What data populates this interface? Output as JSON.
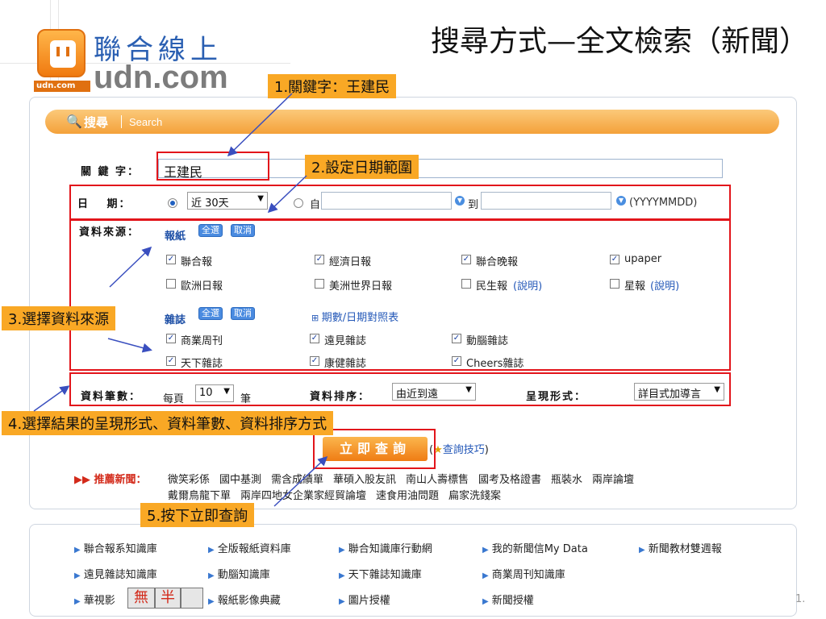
{
  "slide": {
    "title": "搜尋方式—全文檢索（新聞）"
  },
  "logo": {
    "cn": "聯合線上",
    "en": "udn.com",
    "small": "udn.com"
  },
  "search_header": {
    "icon": "search-icon",
    "label": "搜尋",
    "en": "Search"
  },
  "form": {
    "keyword_label": "關 鍵 字：",
    "keyword_value": "王建民",
    "date_label": "日　 期：",
    "date_preset": "近 30天",
    "date_from_label": "自",
    "date_to_label": "到",
    "date_format": "(YYYYMMDD)",
    "source_label": "資料來源：",
    "newspaper_label": "報紙",
    "select_all": "全選",
    "cancel": "取消",
    "newspapers": [
      {
        "name": "聯合報",
        "checked": true
      },
      {
        "name": "經濟日報",
        "checked": true
      },
      {
        "name": "聯合晚報",
        "checked": true
      },
      {
        "name": "upaper",
        "checked": true
      },
      {
        "name": "歐洲日報",
        "checked": false
      },
      {
        "name": "美洲世界日報",
        "checked": false
      },
      {
        "name": "民生報",
        "checked": false,
        "note": "(說明)"
      },
      {
        "name": "星報",
        "checked": false,
        "note": "(說明)"
      }
    ],
    "magazine_label": "雜誌",
    "period_table_link": "期數/日期對照表",
    "magazines": [
      {
        "name": "商業周刊",
        "checked": true
      },
      {
        "name": "遠見雜誌",
        "checked": true
      },
      {
        "name": "動腦雜誌",
        "checked": true
      },
      {
        "name": "天下雜誌",
        "checked": true
      },
      {
        "name": "康健雜誌",
        "checked": true
      },
      {
        "name": "Cheers雜誌",
        "checked": true
      }
    ],
    "count_label": "資料筆數：",
    "per_page_prefix": "每頁",
    "per_page_value": "10",
    "per_page_suffix": "筆",
    "sort_label": "資料排序：",
    "sort_value": "由近到遠",
    "display_label": "呈現形式：",
    "display_value": "詳目式加導言",
    "submit_label": "立即查詢",
    "tips_link": "查詢技巧",
    "tips_open": "(",
    "tips_close": ")"
  },
  "recommend": {
    "label": "推薦新聞：",
    "items_row1": [
      "微笑彩係",
      "國中基測",
      "需含成績單",
      "華碩入股友訊",
      "南山人壽標售",
      "國考及格證書",
      "瓶裝水",
      "兩岸論壇"
    ],
    "items_row2": [
      "戴爾鳥龍下單",
      "兩岸四地女企業家經貿論壇",
      "速食用油問題",
      "扁家洗錢案"
    ]
  },
  "annotations": {
    "step1": "1.關鍵字：王建民",
    "step2": "2.設定日期範圍",
    "step3": "3.選擇資料來源",
    "step4": "4.選擇結果的呈現形式、資料筆數、資料排序方式",
    "step5": "5.按下立即查詢"
  },
  "footer_links": {
    "row1": [
      "聯合報系知識庫",
      "全版報紙資料庫",
      "聯合知識庫行動網",
      "我的新聞信My Data",
      "新聞教材雙週報"
    ],
    "row2": [
      "遠見雜誌知識庫",
      "動腦知識庫",
      "天下雜誌知識庫",
      "商業周刊知識庫"
    ],
    "row3": [
      "華視影",
      "報紙影像典藏",
      "圖片授權",
      "新聞授權"
    ],
    "stamps": [
      "無",
      "半"
    ],
    "page_mark": "1."
  },
  "colors": {
    "accent": "#f4a13a",
    "callout": "#f9a825",
    "highlight": "#e2151b",
    "link": "#2458b8"
  }
}
